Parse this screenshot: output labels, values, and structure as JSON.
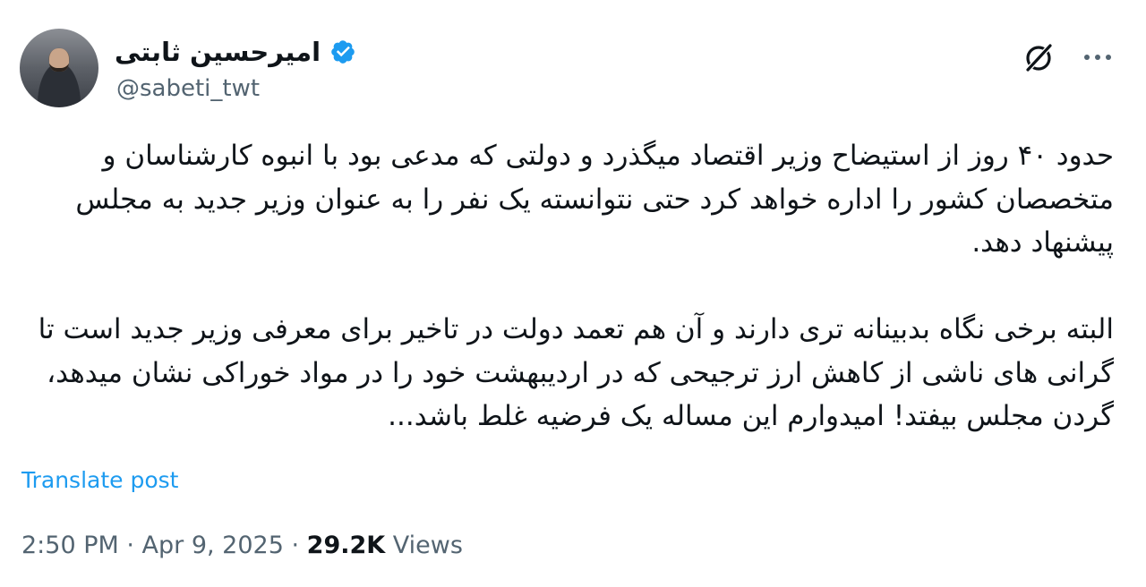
{
  "author": {
    "name": "امیرحسین ثابتی",
    "handle": "@sabeti_twt",
    "verified": true,
    "verified_color": "#1d9bf0"
  },
  "header_icons": [
    "grok-icon",
    "more-icon"
  ],
  "tweet": {
    "paragraphs": [
      "حدود ۴۰ روز از استیضاح وزیر اقتصاد میگذرد و دولتی که مدعی بود با انبوه کارشناسان و متخصصان کشور را اداره خواهد کرد حتی نتوانسته یک نفر را به عنوان وزیر جدید به مجلس پیشنهاد دهد.",
      "البته برخی نگاه بدبینانه تری دارند و آن هم تعمد دولت در تاخیر برای معرفی وزیر جدید است تا گرانی های ناشی از کاهش ارز ترجیحی که در اردیبهشت خود را در مواد خوراکی نشان میدهد، گردن مجلس بیفتد! امیدوارم این مساله یک فرضیه غلط باشد..."
    ]
  },
  "translate_label": "Translate post",
  "meta": {
    "time": "2:50 PM",
    "separator": " · ",
    "date": "Apr 9, 2025",
    "views_count": "29.2K",
    "views_label": " Views"
  },
  "colors": {
    "link": "#1d9bf0",
    "secondary_text": "#536471",
    "primary_text": "#0f1419"
  }
}
